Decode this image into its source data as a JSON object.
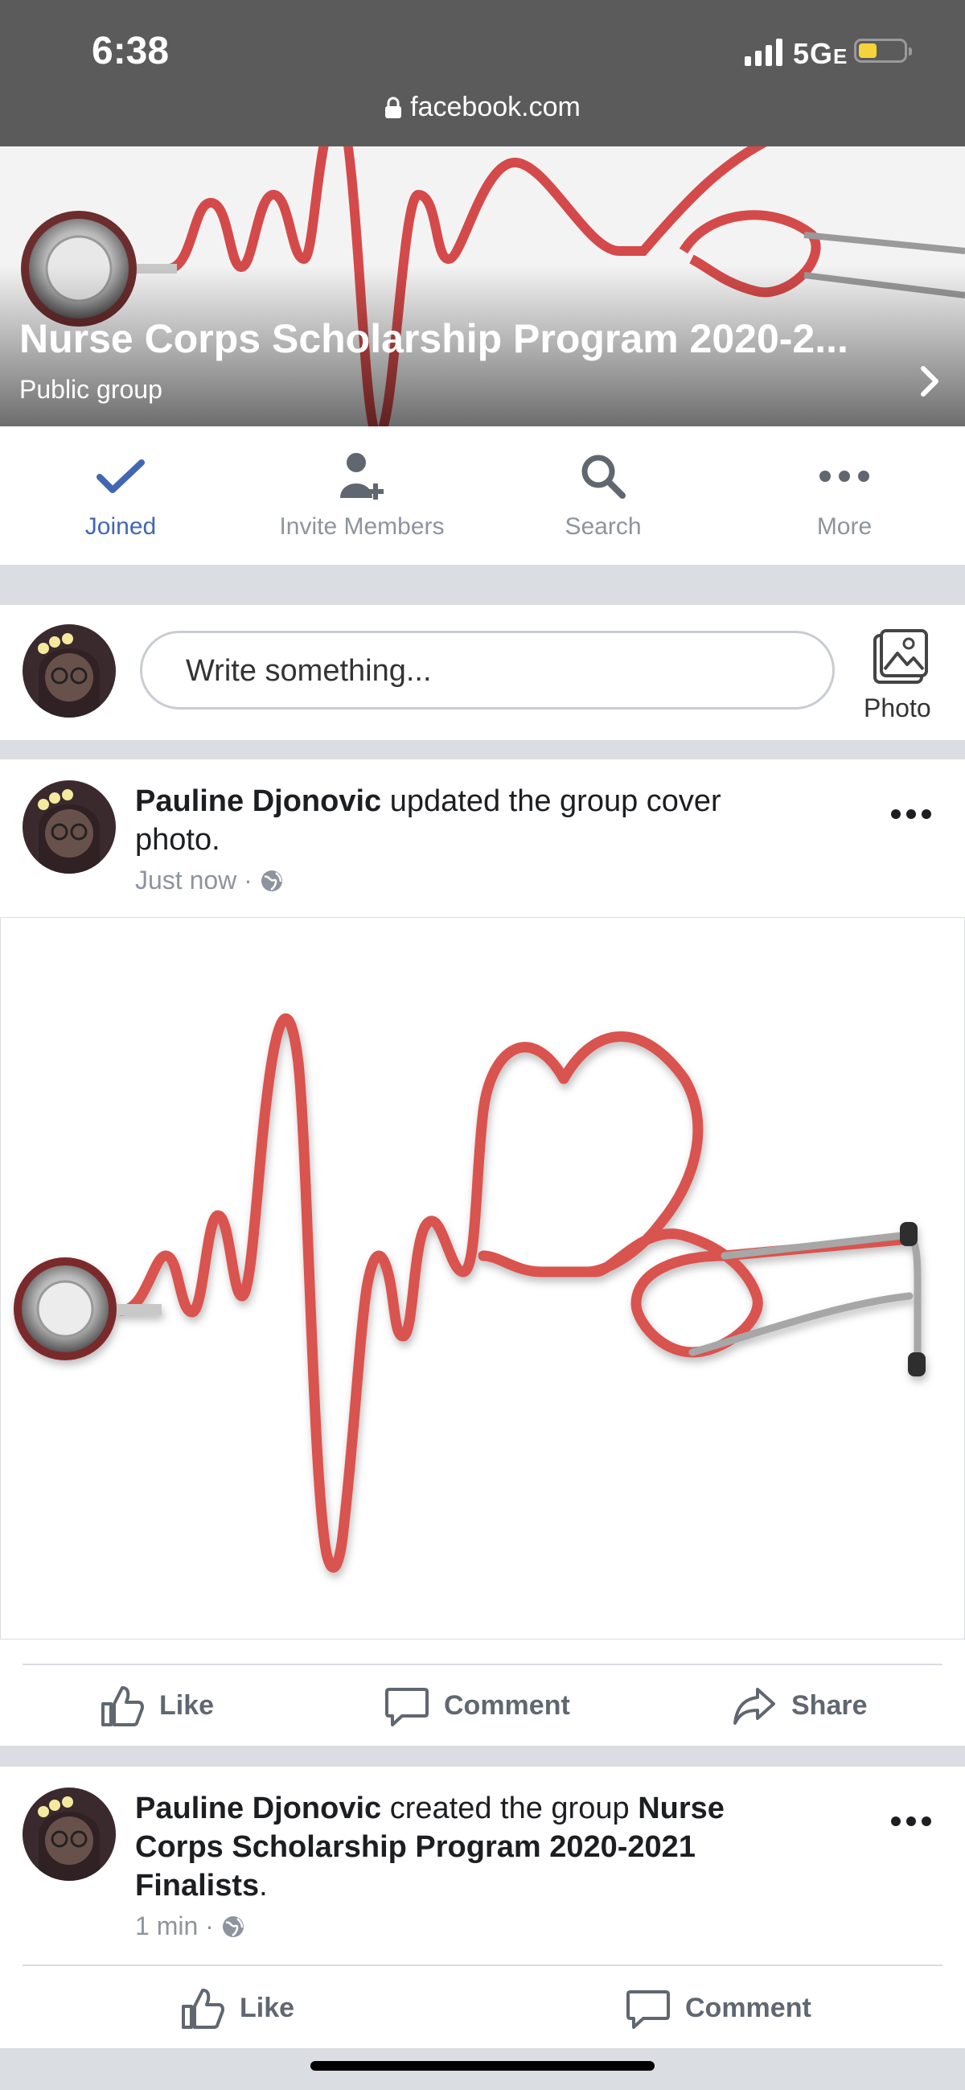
{
  "status_bar": {
    "time": "6:38",
    "network": "5G",
    "network_suffix": "E",
    "url": "facebook.com"
  },
  "group": {
    "title": "Nurse Corps Scholarship Program 2020-2...",
    "privacy": "Public group"
  },
  "actions": [
    {
      "label": "Joined",
      "icon": "checkmark-icon"
    },
    {
      "label": "Invite Members",
      "icon": "add-person-icon"
    },
    {
      "label": "Search",
      "icon": "search-icon"
    },
    {
      "label": "More",
      "icon": "more-dots-icon"
    }
  ],
  "composer": {
    "placeholder": "Write something...",
    "photo_label": "Photo"
  },
  "posts": [
    {
      "author": "Pauline Djonovic",
      "action_text": "updated the group cover photo.",
      "time": "Just now",
      "buttons": {
        "like": "Like",
        "comment": "Comment",
        "share": "Share"
      }
    },
    {
      "author": "Pauline Djonovic",
      "action_text": "created the group",
      "group_name": "Nurse Corps Scholarship Program 2020-2021 Finalists",
      "period": ".",
      "time": "1 min",
      "buttons": {
        "like": "Like",
        "comment": "Comment"
      }
    }
  ],
  "colors": {
    "accent": "#4267b2",
    "status_bg": "#5b5b5b",
    "stethoscope_red": "#d9534f"
  }
}
